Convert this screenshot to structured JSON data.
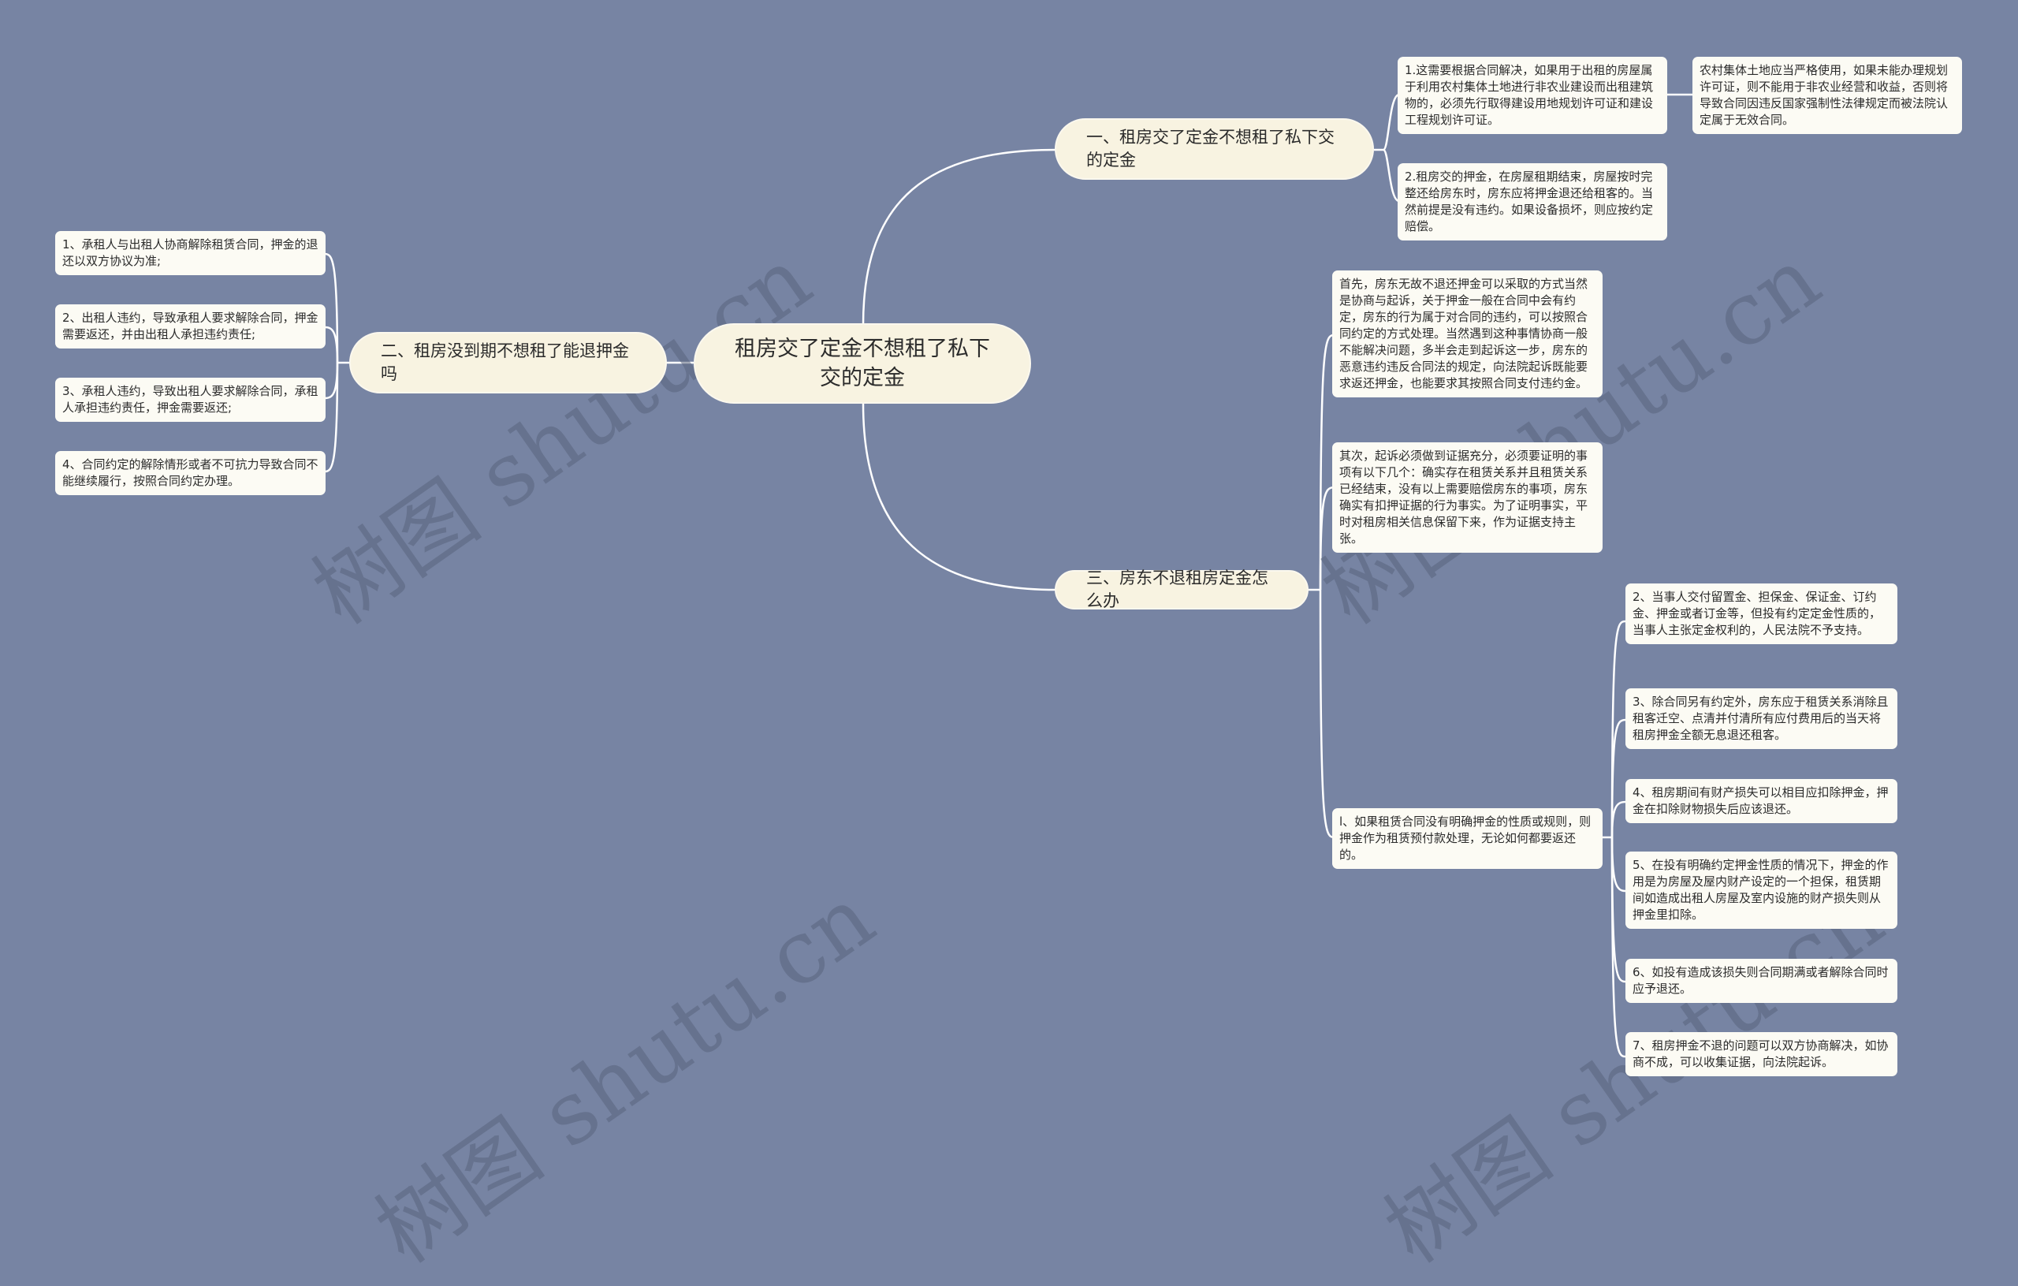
{
  "watermark": "树图 shutu.cn",
  "colors": {
    "background": "#7784a3",
    "node_fill": "#f8f3e1",
    "leaf_fill": "#fcfbf4",
    "connector": "#ffffff"
  },
  "root": {
    "label": "租房交了定金不想租了私下交的定金"
  },
  "branches": [
    {
      "label": "一、租房交了定金不想租了私下交的定金",
      "children": [
        {
          "text": "1.这需要根据合同解决，如果用于出租的房屋属于利用农村集体土地进行非农业建设而出租建筑物的，必须先行取得建设用地规划许可证和建设工程规划许可证。",
          "children": [
            {
              "text": "农村集体土地应当严格使用，如果未能办理规划许可证，则不能用于非农业经营和收益，否则将导致合同因违反国家强制性法律规定而被法院认定属于无效合同。"
            }
          ]
        },
        {
          "text": "2.租房交的押金，在房屋租期结束，房屋按时完整还给房东时，房东应将押金退还给租客的。当然前提是没有违约。如果设备损坏，则应按约定赔偿。"
        }
      ]
    },
    {
      "label": "二、租房没到期不想租了能退押金吗",
      "children": [
        {
          "text": "1、承租人与出租人协商解除租赁合同，押金的退还以双方协议为准;"
        },
        {
          "text": "2、出租人违约，导致承租人要求解除合同，押金需要返还，并由出租人承担违约责任;"
        },
        {
          "text": "3、承租人违约，导致出租人要求解除合同，承租人承担违约责任，押金需要返还;"
        },
        {
          "text": "4、合同约定的解除情形或者不可抗力导致合同不能继续履行，按照合同约定办理。"
        }
      ]
    },
    {
      "label": "三、房东不退租房定金怎么办",
      "children": [
        {
          "text": "首先，房东无故不退还押金可以采取的方式当然是协商与起诉，关于押金一般在合同中会有约定，房东的行为属于对合同的违约，可以按照合同约定的方式处理。当然遇到这种事情协商一般不能解决问题，多半会走到起诉这一步，房东的恶意违约违反合同法的规定，向法院起诉既能要求返还押金，也能要求其按照合同支付违约金。"
        },
        {
          "text": "其次，起诉必须做到证据充分，必须要证明的事项有以下几个：确实存在租赁关系并且租赁关系已经结束，没有以上需要赔偿房东的事项，房东确实有扣押证据的行为事实。为了证明事实，平时对租房相关信息保留下来，作为证据支持主张。"
        },
        {
          "text": "l、如果租赁合同没有明确押金的性质或规则，则押金作为租赁预付款处理，无论如何都要返还的。",
          "children": [
            {
              "text": "2、当事人交付留置金、担保金、保证金、订约金、押金或者订金等，但投有约定定金性质的，当事人主张定金权利的，人民法院不予支持。"
            },
            {
              "text": "3、除合同另有约定外，房东应于租赁关系消除且租客迁空、点清并付清所有应付费用后的当天将租房押金全额无息退还租客。"
            },
            {
              "text": "4、租房期间有财产损失可以相目应扣除押金，押金在扣除财物损失后应该退还。"
            },
            {
              "text": "5、在投有明确约定押金性质的情况下，押金的作用是为房屋及屋内财产设定的一个担保，租赁期间如造成出租人房屋及室内设施的财产损失则从押金里扣除。"
            },
            {
              "text": "6、如投有造成该损失则合同期满或者解除合同时应予退还。"
            },
            {
              "text": "7、租房押金不退的问题可以双方协商解决，如协商不成，可以收集证据，向法院起诉。"
            }
          ]
        }
      ]
    }
  ]
}
